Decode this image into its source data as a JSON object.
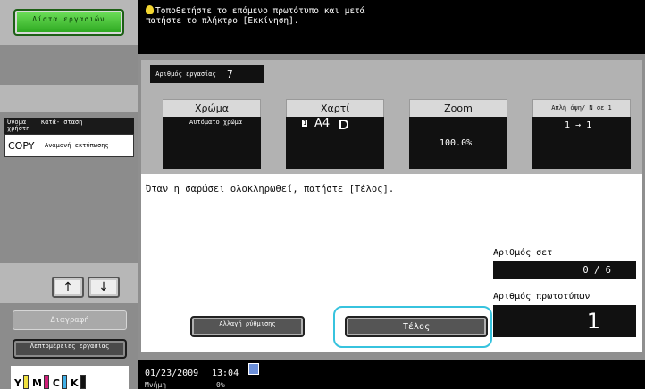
{
  "left_panel": {
    "job_list_button": "Λίστα εργασιών",
    "job_list_header": {
      "col_user": "Όνομα χρήστη",
      "col_status": "Κατά- σταση"
    },
    "job_row": {
      "user": "COPY",
      "status": "Αναμονή εκτύπωσης"
    },
    "up_arrow": "↑",
    "down_arrow": "↓",
    "delete_label": "Διαγραφή",
    "job_details_label": "Λεπτομέρειες εργασίας",
    "toner": [
      {
        "label": "Y",
        "color": "#f0e040"
      },
      {
        "label": "M",
        "color": "#d0207a"
      },
      {
        "label": "C",
        "color": "#40b0e8"
      },
      {
        "label": "K",
        "color": "#111111"
      }
    ]
  },
  "message": {
    "icon": "bulb-icon",
    "line1": "Τοποθετήστε το επόμενο πρωτότυπο και μετά",
    "line2": "πατήστε το πλήκτρο [Εκκίνηση]."
  },
  "job_number": {
    "label": "Αριθμός εργασίας",
    "value": "7"
  },
  "settings": {
    "color": {
      "header": "Χρώμα",
      "value": "Αυτόματο χρώμα"
    },
    "paper": {
      "header": "Χαρτί",
      "tray": "1",
      "value": "A4"
    },
    "zoom": {
      "header": "Zoom",
      "value": "100.0%"
    },
    "duplex": {
      "header": "Απλή όψη/ Ν σε 1",
      "value": "1 → 1"
    }
  },
  "instruction": "Όταν η σαρώσει ολοκληρωθεί, πατήστε [Τέλος].",
  "sets": {
    "label": "Αριθμός σετ",
    "value": "0 / 6"
  },
  "originals": {
    "label": "Αριθμός πρωτοτύπων",
    "value": "1"
  },
  "buttons": {
    "change_settings": "Αλλαγή ρύθμισης",
    "finish": "Τέλος"
  },
  "status_bar": {
    "date": "01/23/2009",
    "time": "13:04",
    "memory_label": "Μνήμη",
    "memory_value": "0%"
  },
  "colors": {
    "finish_highlight": "#37c3de",
    "start_green": "#29a51d"
  }
}
